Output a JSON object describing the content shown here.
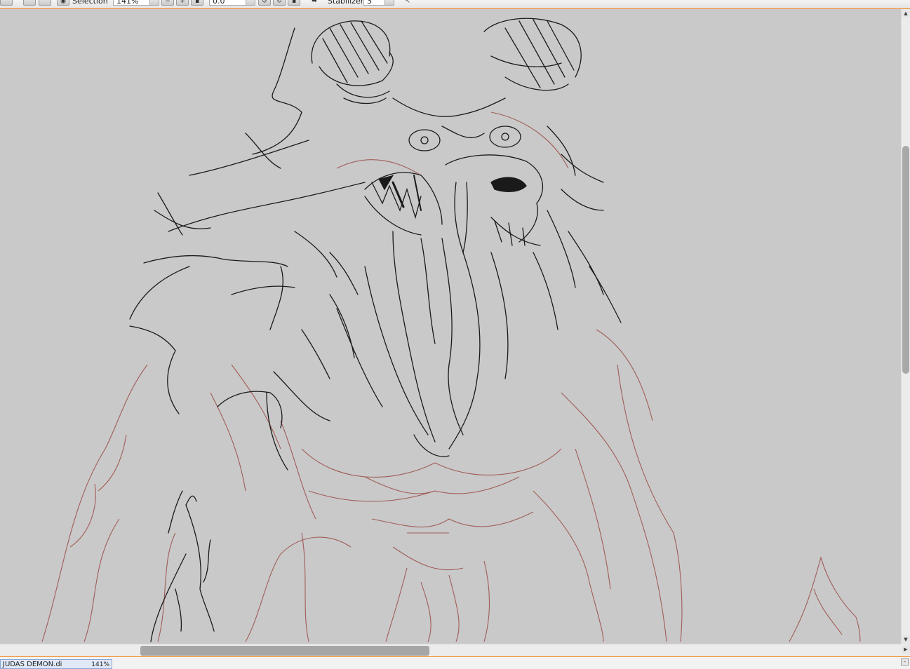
{
  "toolbar": {
    "selection_label": "Selection",
    "zoom_value": "141%",
    "angle_value": "0.0",
    "stabilizer_label": "Stabilizer",
    "stabilizer_value": "3"
  },
  "document_tab": {
    "title": "JUDAS DEMON.di",
    "zoom": "141%"
  },
  "scrollbars": {
    "horizontal_glyph_right": "▶",
    "vertical_glyph_up": "▲",
    "vertical_glyph_down": "▼"
  },
  "colors": {
    "canvas": "#c9c9c9",
    "accent_border": "#f08a24",
    "ink_line": "#1a1a1a",
    "sketch_line": "#9a4a44"
  }
}
